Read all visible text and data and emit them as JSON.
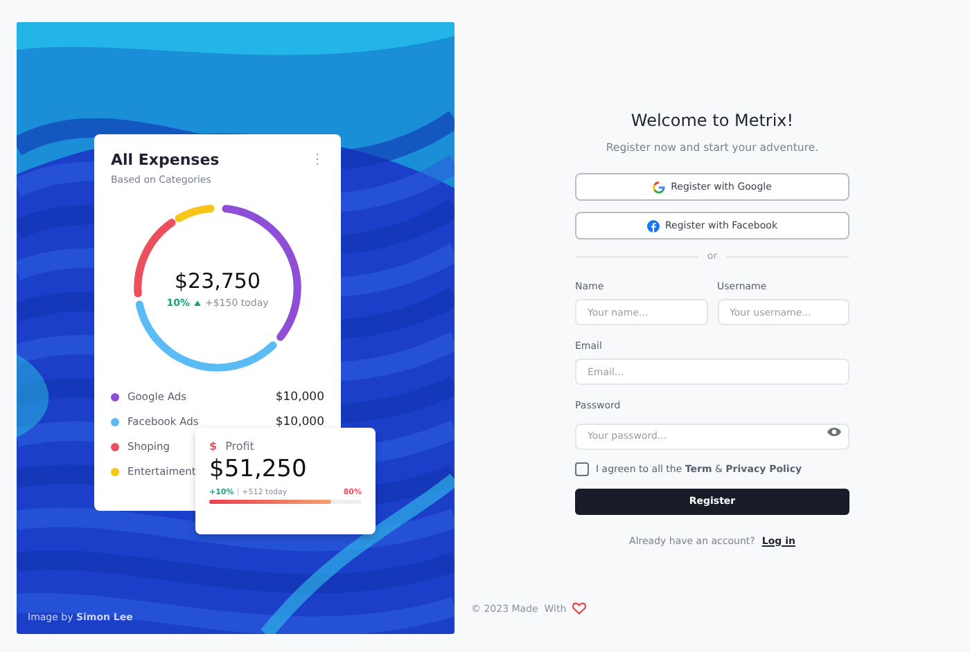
{
  "hero": {
    "credit": "Image by **Simon Lee**",
    "expenses": {
      "title": "All Expenses",
      "subtitle": "Based on Categories",
      "menu": "⋮",
      "total": "$23,750",
      "change": "10%",
      "trend": "+$150 today",
      "legend": [
        {
          "name": "Google Ads",
          "amount": "$10,000",
          "color": "#8e4fd6"
        },
        {
          "name": "Facebook Ads",
          "amount": "$10,000",
          "color": "#5bbcf5"
        },
        {
          "name": "Shoping",
          "color": "#ec4f5d"
        },
        {
          "name": "Entertaiment",
          "color": "#f7c518"
        }
      ]
    },
    "profit": {
      "icon": "$",
      "label": "Profit",
      "value": "$51,250",
      "change": "+10%",
      "separator": "|",
      "trend": "+512 today",
      "percent": "80%",
      "level": 0.8
    }
  },
  "form": {
    "title": "Welcome to Metrix!",
    "subtitle": "Register now and start your adventure.",
    "social": [
      {
        "kind": "google",
        "label": "Register with Google"
      },
      {
        "kind": "facebook",
        "label": "Register with Facebook"
      }
    ],
    "divider": "or",
    "name": {
      "label": "Name",
      "placeholder": "Your name..."
    },
    "username": {
      "label": "Username",
      "placeholder": "Your username..."
    },
    "email": {
      "label": "Email",
      "placeholder": "Email..."
    },
    "password": {
      "label": "Password",
      "placeholder": "Your password..."
    },
    "agree": {
      "text": "I agreen to all the **Term** & **Privacy Policy**",
      "checked": false
    },
    "submit": "Register",
    "login_prompt": "Already have an account?",
    "login_link": "Log in"
  },
  "footer": {
    "text": "© 2023 Made  With"
  }
}
